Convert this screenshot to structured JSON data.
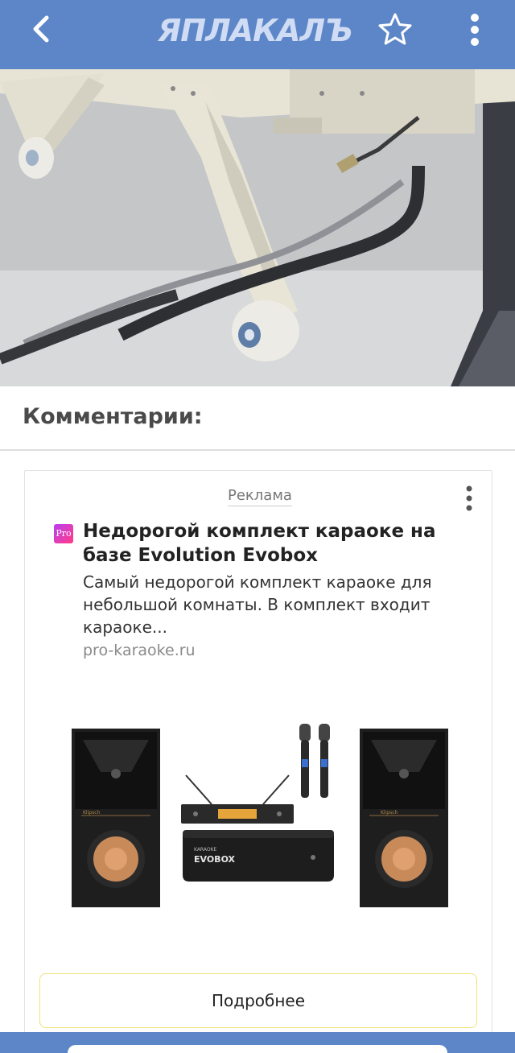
{
  "header": {
    "logo": "ЯПЛАКАЛЪ",
    "back_icon": "chevron-left-icon",
    "favorite_icon": "star-outline-icon",
    "menu_icon": "vertical-dots-icon"
  },
  "comments": {
    "title": "Комментарии:"
  },
  "ad": {
    "tag": "Реклама",
    "brand_icon_text": "Pro",
    "title": "Недорогой комплект караоке на базе Evolution Evobox",
    "description": "Самый недорогой комплект караоке для небольшой комнаты. В комплект входит караоке...",
    "domain": "pro-karaoke.ru",
    "image": {
      "left_speaker_brand": "Klipsch",
      "right_speaker_brand": "Klipsch",
      "box_brand": "EVOBOX",
      "box_subtitle": "KARAOKE"
    },
    "button_label": "Подробнее"
  },
  "colors": {
    "top_bar": "#5d86c8",
    "logo": "#cfdcf3",
    "button_border": "#f1e27a"
  }
}
